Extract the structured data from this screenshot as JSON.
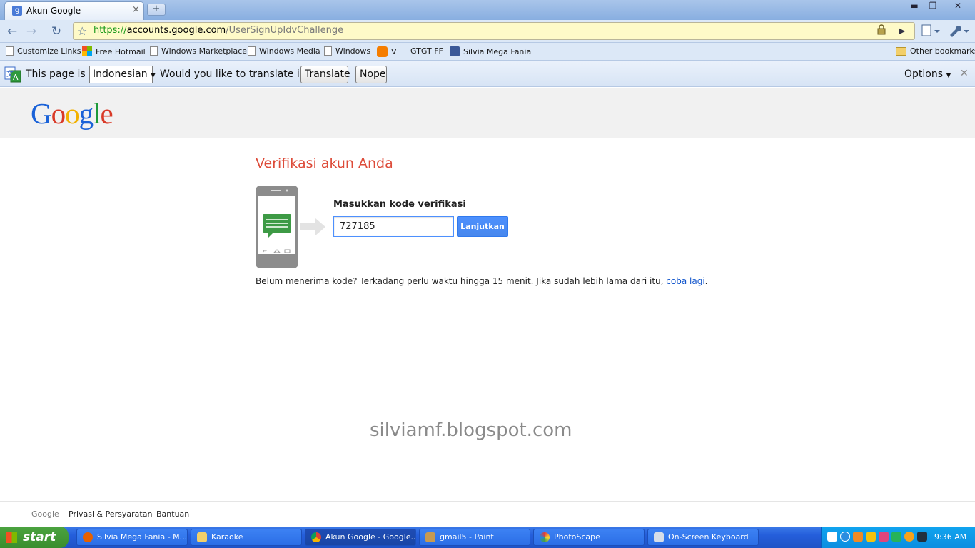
{
  "browser": {
    "tab_title": "Akun Google",
    "tab_favicon_glyph": "g",
    "new_tab_glyph": "+",
    "close_glyph": "×",
    "window_controls": {
      "minimize": "▬",
      "restore": "❐",
      "close": "✕"
    },
    "url_scheme": "https://",
    "url_host": "accounts.google.com",
    "url_path": "/UserSignUpIdvChallenge",
    "nav": {
      "back": "←",
      "forward": "→",
      "reload": "↻",
      "star": "☆"
    }
  },
  "bookmarks": {
    "items": [
      {
        "label": "Customize Links",
        "icon": "page-icon"
      },
      {
        "label": "Free Hotmail",
        "icon": "windows-icon"
      },
      {
        "label": "Windows Marketplace",
        "icon": "page-icon"
      },
      {
        "label": "Windows Media",
        "icon": "page-icon"
      },
      {
        "label": "Windows",
        "icon": "page-icon"
      },
      {
        "label": "V",
        "icon": "blogger-icon"
      },
      {
        "label": "GTGT FF",
        "icon": "none"
      },
      {
        "label": "Silvia Mega Fania",
        "icon": "facebook-icon"
      }
    ],
    "other": "Other bookmarks"
  },
  "translate_bar": {
    "prefix": "This page is in",
    "language": "Indonesian",
    "question": "Would you like to translate it?",
    "translate_button": "Translate",
    "nope_button": "Nope",
    "options": "Options",
    "close": "✕"
  },
  "page": {
    "logo": [
      "G",
      "o",
      "o",
      "g",
      "l",
      "e"
    ],
    "logo_colors": [
      "#1a62d8",
      "#d93a28",
      "#f2b100",
      "#1a62d8",
      "#1d9a3a",
      "#d93a28"
    ],
    "heading": "Verifikasi akun Anda",
    "code_label": "Masukkan kode verifikasi",
    "code_value": "727185",
    "submit_label": "Lanjutkan",
    "help_text": "Belum menerima kode? Terkadang perlu waktu hingga 15 menit. Jika sudah lebih lama dari itu, ",
    "retry_link": "coba lagi",
    "help_suffix": ".",
    "watermark": "silviamf.blogspot.com"
  },
  "footer": {
    "brand": "Google",
    "privacy": "Privasi & Persyaratan",
    "help": "Bantuan"
  },
  "taskbar": {
    "start": "start",
    "tasks": [
      {
        "label": "Silvia Mega Fania - M...",
        "icon": "firefox-icon",
        "active": false
      },
      {
        "label": "Karaoke",
        "icon": "folder-icon",
        "active": false
      },
      {
        "label": "Akun Google - Google...",
        "icon": "chrome-icon",
        "active": true
      },
      {
        "label": "gmail5 - Paint",
        "icon": "paint-icon",
        "active": false
      },
      {
        "label": "PhotoScape",
        "icon": "photoscape-icon",
        "active": false
      },
      {
        "label": "On-Screen Keyboard",
        "icon": "keyboard-icon",
        "active": false
      }
    ],
    "clock": "9:36 AM"
  }
}
